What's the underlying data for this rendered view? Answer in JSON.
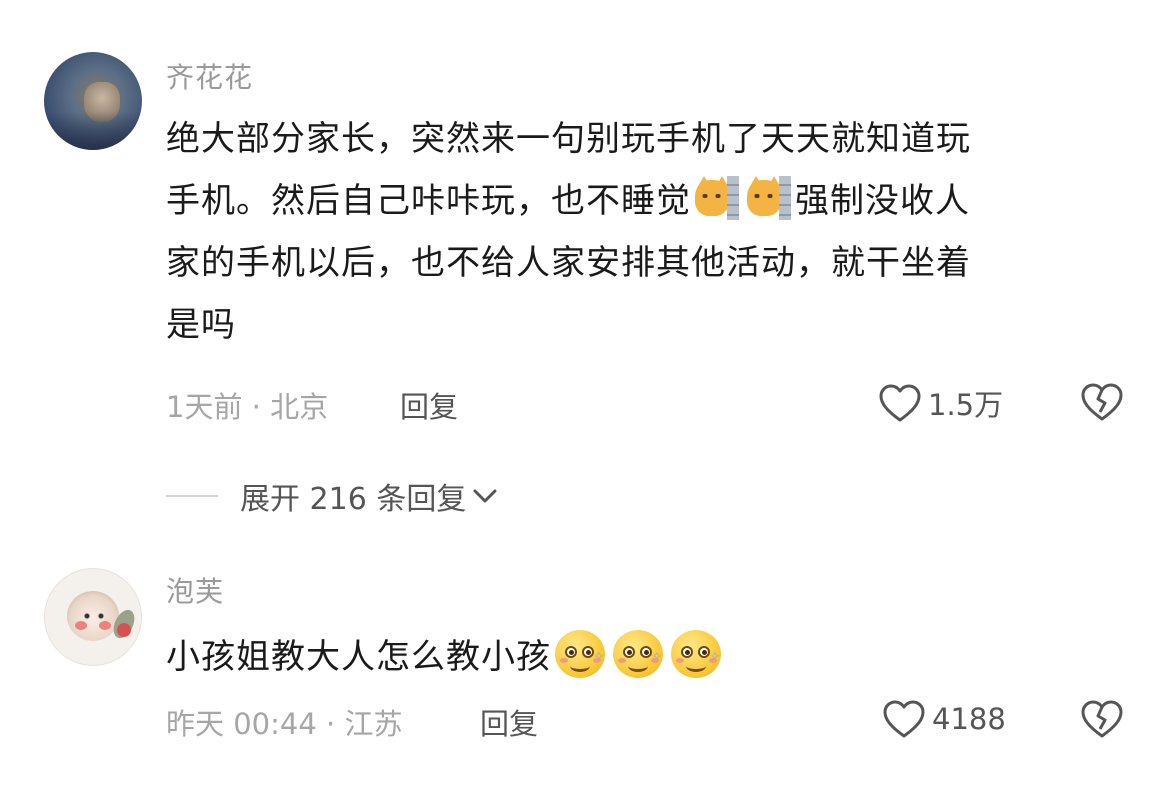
{
  "comments": [
    {
      "username": "齐花花",
      "lines": [
        "绝大部分家长，突然来一句别玩手机了天天就知道玩",
        "手机。然后自己咔咔玩，也不睡觉",
        "强制没收人",
        "家的手机以后，也不给人家安排其他活动，就干坐着",
        "是吗"
      ],
      "emojis": [
        "cat-peek-emoji",
        "cat-peek-emoji"
      ],
      "meta": "1天前 · 北京",
      "reply_label": "回复",
      "likes": "1.5万"
    },
    {
      "username": "泡芙",
      "text": "小孩姐教大人怎么教小孩",
      "emojis": [
        "smile-emoji",
        "smile-emoji",
        "smile-emoji"
      ],
      "meta": "昨天 00:44 · 江苏",
      "reply_label": "回复",
      "likes": "4188"
    }
  ],
  "expand_replies": "展开 216 条回复",
  "icons": [
    "heart-icon",
    "dislike-heart-icon",
    "chevron-down-icon"
  ]
}
